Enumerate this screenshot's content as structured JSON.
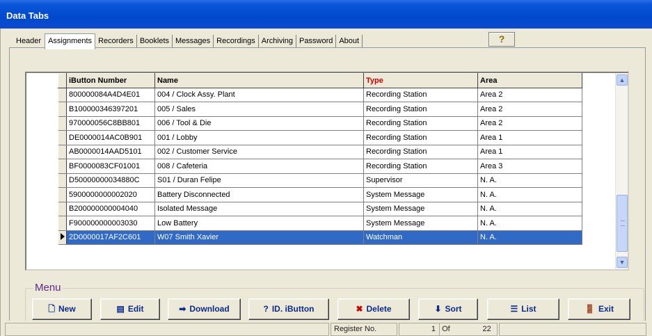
{
  "window": {
    "title": "Data Tabs"
  },
  "tabs": [
    {
      "label": "Header"
    },
    {
      "label": "Assignments"
    },
    {
      "label": "Recorders"
    },
    {
      "label": "Booklets"
    },
    {
      "label": "Messages"
    },
    {
      "label": "Recordings"
    },
    {
      "label": "Archiving"
    },
    {
      "label": "Password"
    },
    {
      "label": "About"
    }
  ],
  "help_button": {
    "icon": "question-mark-icon",
    "label": "?"
  },
  "grid": {
    "columns": [
      "iButton Number",
      "Name",
      "Type",
      "Area"
    ],
    "rows": [
      {
        "ibutton": "800000084A4D4E01",
        "name": "004 / Clock Assy. Plant",
        "type": "Recording Station",
        "area": "Area 2"
      },
      {
        "ibutton": "B100000346397201",
        "name": "005 / Sales",
        "type": "Recording Station",
        "area": "Area 2"
      },
      {
        "ibutton": "970000056C8BB801",
        "name": "006 / Tool & Die",
        "type": "Recording Station",
        "area": "Area 2"
      },
      {
        "ibutton": "DE0000014AC0B901",
        "name": "001 / Lobby",
        "type": "Recording Station",
        "area": "Area 1"
      },
      {
        "ibutton": "AB0000014AAD5101",
        "name": "002 / Customer Service",
        "type": "Recording Station",
        "area": "Area 1"
      },
      {
        "ibutton": "BF0000083CF01001",
        "name": "008 / Cafeteria",
        "type": "Recording Station",
        "area": "Area 3"
      },
      {
        "ibutton": "D50000000034880C",
        "name": "S01 / Duran Felipe",
        "type": "Supervisor",
        "area": "N. A."
      },
      {
        "ibutton": "5900000000002020",
        "name": "Battery Disconnected",
        "type": "System Message",
        "area": "N. A."
      },
      {
        "ibutton": "B200000000004040",
        "name": "Isolated Message",
        "type": "System Message",
        "area": "N. A."
      },
      {
        "ibutton": "F900000000003030",
        "name": "Low Battery",
        "type": "System Message",
        "area": "N. A."
      },
      {
        "ibutton": "2D0000017AF2C601",
        "name": "W07 Smith Xavier",
        "type": "Watchman",
        "area": "N. A."
      }
    ],
    "selected_row": 10,
    "type_header_color": "#cc0000",
    "selection_color": "#316ac5"
  },
  "menu": {
    "legend": "Menu",
    "buttons": [
      {
        "label": "New",
        "icon": "new-document-icon"
      },
      {
        "label": "Edit",
        "icon": "edit-icon"
      },
      {
        "label": "Download",
        "icon": "download-arrow-icon"
      },
      {
        "label": "ID. iButton",
        "icon": "question-mark-icon"
      },
      {
        "label": "Delete",
        "icon": "delete-icon"
      },
      {
        "label": "Sort",
        "icon": "sort-arrow-icon"
      },
      {
        "label": "List",
        "icon": "list-icon"
      },
      {
        "label": "Exit",
        "icon": "exit-door-icon"
      }
    ]
  },
  "status": {
    "register_label": "Register No.",
    "current": "1",
    "of_label": "Of",
    "total": "22"
  }
}
